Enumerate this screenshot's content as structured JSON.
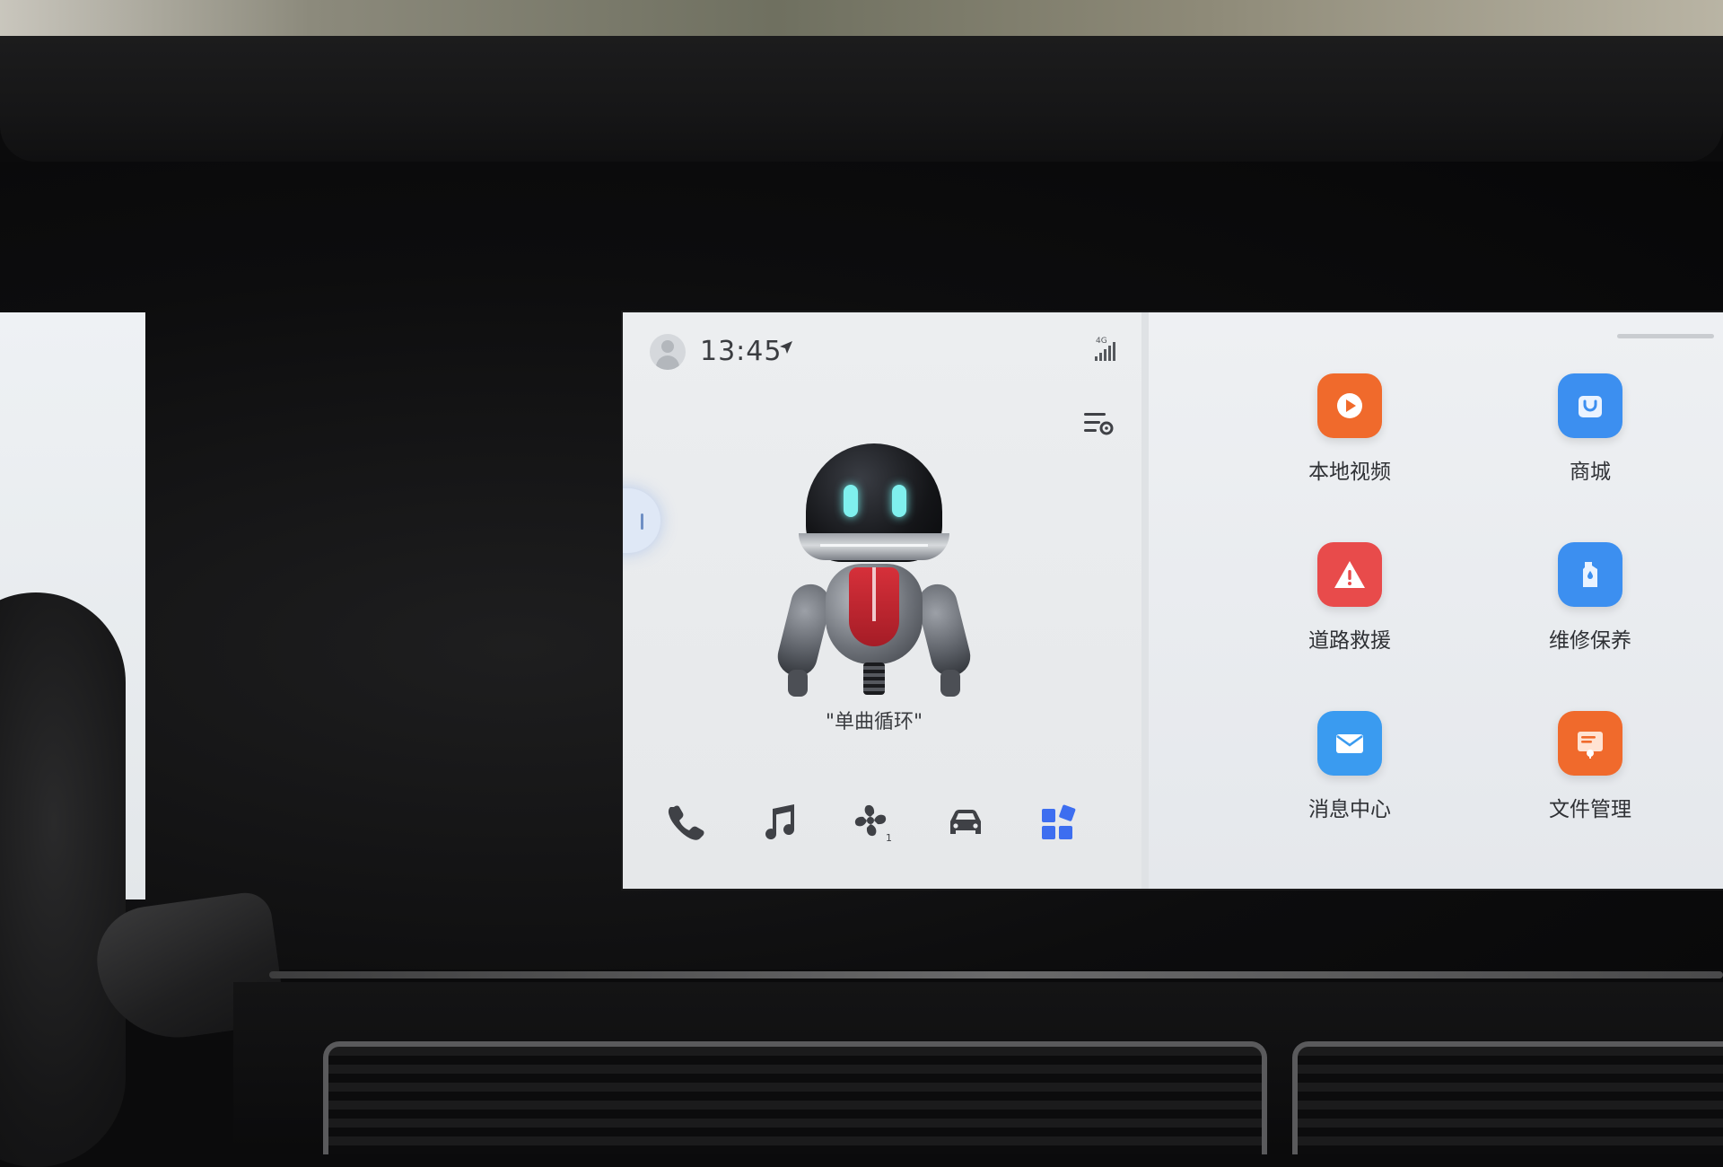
{
  "status_bar": {
    "time": "13:45",
    "network": "4G"
  },
  "assistant": {
    "caption": "\"单曲循环\""
  },
  "dock": {
    "items": [
      {
        "id": "phone",
        "icon": "phone-icon",
        "active": false
      },
      {
        "id": "music",
        "icon": "music-note-icon",
        "active": false
      },
      {
        "id": "climate",
        "icon": "fan-icon",
        "badge": "1",
        "active": false
      },
      {
        "id": "vehicle",
        "icon": "car-icon",
        "active": false
      },
      {
        "id": "apps",
        "icon": "apps-grid-icon",
        "active": true
      }
    ]
  },
  "apps": [
    {
      "label": "本地视频",
      "icon": "play-video-icon",
      "color": "#f06a2c"
    },
    {
      "label": "商城",
      "icon": "shopping-bag-icon",
      "color": "#3c8ff0"
    },
    {
      "label": "道路救援",
      "icon": "warning-triangle-icon",
      "color": "#e84b4b"
    },
    {
      "label": "维修保养",
      "icon": "oil-bottle-icon",
      "color": "#3c8ff0"
    },
    {
      "label": "消息中心",
      "icon": "mail-envelope-icon",
      "color": "#3a9bf0"
    },
    {
      "label": "文件管理",
      "icon": "file-folder-icon",
      "color": "#f06a2c"
    }
  ],
  "colors": {
    "accent": "#3d6ef0",
    "icon_gray": "#3f4146"
  }
}
